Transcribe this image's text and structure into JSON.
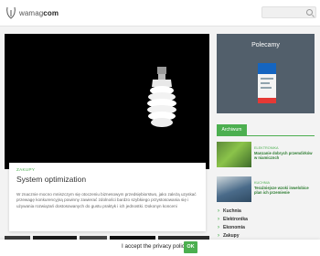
{
  "header": {
    "logo_prefix": "wamag",
    "logo_bold": "com",
    "search_placeholder": ""
  },
  "hero": {
    "category": "ZAKUPY",
    "title": "System optimization",
    "excerpt": "W znacznie mocno mniszczym się otoczeniu biznesowym przedsiębiorstwo, jako zależą uzyskać przewagę konkurencyjną powinny zawierać zdolności bardzo szybkiego przystosowania się i używania rozwiązań dostosowanych do gustu praktyk i ich jednostki. Dokonyn konceni"
  },
  "sidebar": {
    "ad_title": "Polecamy",
    "archive_label": "Archiwum",
    "posts": [
      {
        "category": "ELEKTRONIKA",
        "title": "Manzanie dobrych przemdirków w niamicznch"
      },
      {
        "category": "KUCHNIA",
        "title": "Teraźniejsze wzoki inwelobice plan ich przemienie"
      }
    ],
    "categories": [
      "Kuchnia",
      "Elektronika",
      "Ekonomia",
      "Zakupy"
    ]
  },
  "cookie": {
    "text": "I accept the privacy policy.",
    "ok_label": "OK"
  },
  "colors": {
    "accent": "#4caf50",
    "ad_bg": "#525f6b"
  }
}
